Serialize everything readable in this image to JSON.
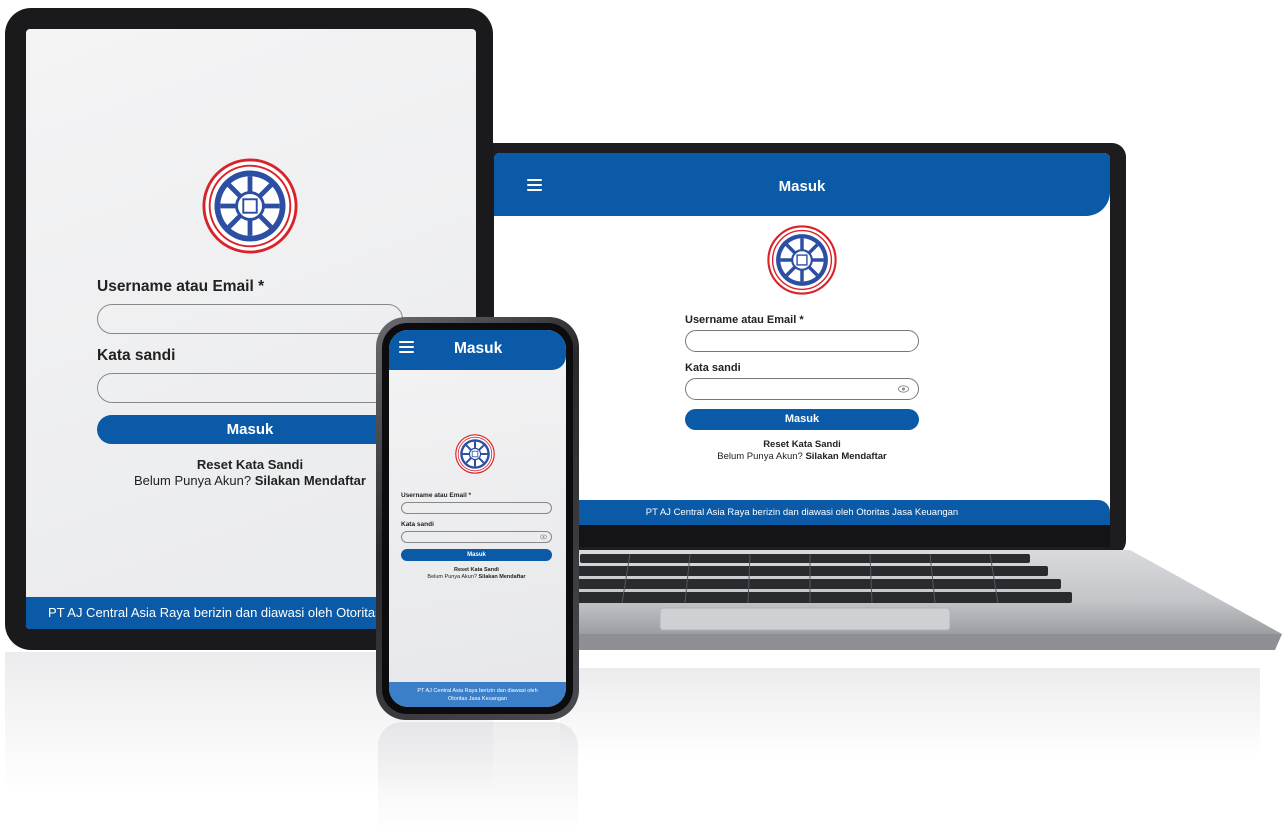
{
  "app": {
    "title": "Masuk",
    "brand_color": "#0a5aa8",
    "logo_icon": "central-asia-raya-emblem-icon",
    "menu_icon": "hamburger-menu-icon"
  },
  "form": {
    "username_label": "Username atau Email *",
    "username_value": "",
    "password_label": "Kata sandi",
    "password_value": "",
    "password_toggle_icon": "eye-icon",
    "submit_label": "Masuk",
    "reset_link": "Reset Kata Sandi",
    "register_prompt": "Belum Punya Akun?",
    "register_link": "Silakan Mendaftar"
  },
  "footer": {
    "text": "PT AJ Central Asia Raya berizin dan diawasi oleh Otoritas Jasa Keuangan",
    "text_line1": "PT AJ Central Asia Raya berizin dan diawasi oleh",
    "text_line2": "Otoritas Jasa Keuangan",
    "tablet_text": "PT AJ Central Asia Raya berizin dan diawasi oleh Otoritas Jasa"
  }
}
